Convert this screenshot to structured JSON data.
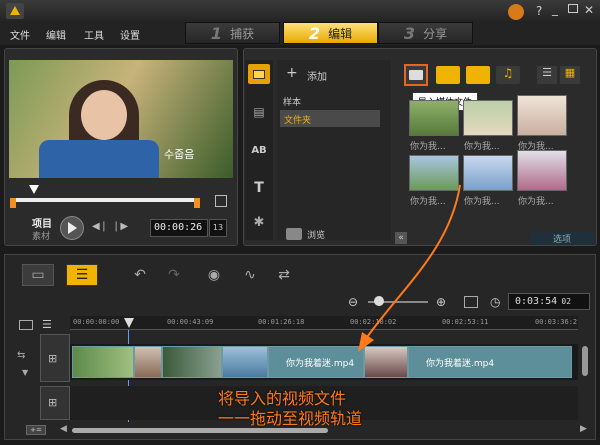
{
  "app": {
    "logo_icon": "corel-logo-icon"
  },
  "menu": [
    "文件",
    "编辑",
    "工具",
    "设置"
  ],
  "steps": [
    {
      "num": "1",
      "label": "捕获",
      "active": false
    },
    {
      "num": "2",
      "label": "编辑",
      "active": true
    },
    {
      "num": "3",
      "label": "分享",
      "active": false
    }
  ],
  "player": {
    "overlay_text": "수줍음",
    "mode_project": "项目",
    "mode_clip": "素材",
    "timecode": "00:00:26",
    "timecode_frames": "13"
  },
  "library": {
    "add_label": "添加",
    "folders": [
      "样本",
      "文件夹"
    ],
    "selected_folder": "文件夹",
    "browse_label": "浏览",
    "tooltip": "导入媒体文件",
    "options_label": "选项",
    "thumb_captions": [
      "你为我...",
      "你为我...",
      "你为我...",
      "你为我...",
      "你为我...",
      "你为我..."
    ]
  },
  "timeline": {
    "zoom_time": "0:03:54",
    "zoom_frames": "02",
    "ruler": [
      "00:00:00:00",
      "00:00:43:09",
      "00:01:26:18",
      "00:02:10:02",
      "00:02:53:11",
      "00:03:36:2"
    ],
    "clip_labels": [
      "你为我着迷.mp4",
      "你为我着迷.mp4"
    ]
  },
  "annotation": {
    "line1": "将导入的视频文件",
    "line2": "一一拖动至视频轨道",
    "color": "#ff7a1a"
  },
  "colors": {
    "accent": "#f0b400",
    "highlight": "#e8661a",
    "track": "#5d8f9a"
  }
}
